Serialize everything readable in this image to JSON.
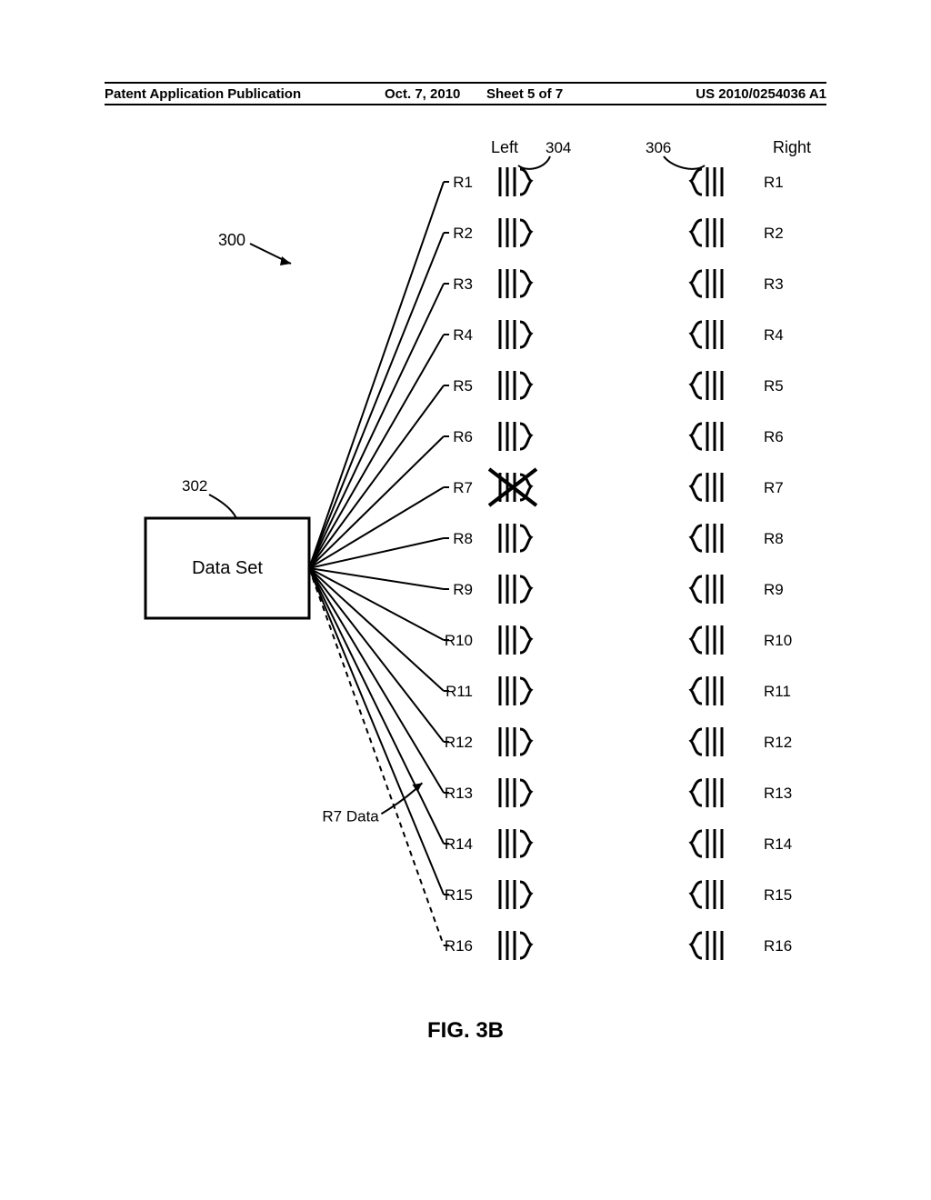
{
  "header": {
    "left": "Patent Application Publication",
    "date": "Oct. 7, 2010",
    "sheet": "Sheet 5 of 7",
    "pubno": "US 2010/0254036 A1"
  },
  "figure": {
    "caption": "FIG. 3B",
    "ref_main": "300",
    "ref_dataset": "302",
    "ref_left": "304",
    "ref_right": "306",
    "dataset_label": "Data Set",
    "left_col_label": "Left",
    "right_col_label": "Right",
    "r7data_label": "R7 Data",
    "left_rows": [
      "R1",
      "R2",
      "R3",
      "R4",
      "R5",
      "R6",
      "R7",
      "R8",
      "R9",
      "R10",
      "R11",
      "R12",
      "R13",
      "R14",
      "R15",
      "R16"
    ],
    "right_rows": [
      "R1",
      "R2",
      "R3",
      "R4",
      "R5",
      "R6",
      "R7",
      "R8",
      "R9",
      "R10",
      "R11",
      "R12",
      "R13",
      "R14",
      "R15",
      "R16"
    ],
    "crossed_row_index": 6,
    "dashed_row_index": 15
  }
}
